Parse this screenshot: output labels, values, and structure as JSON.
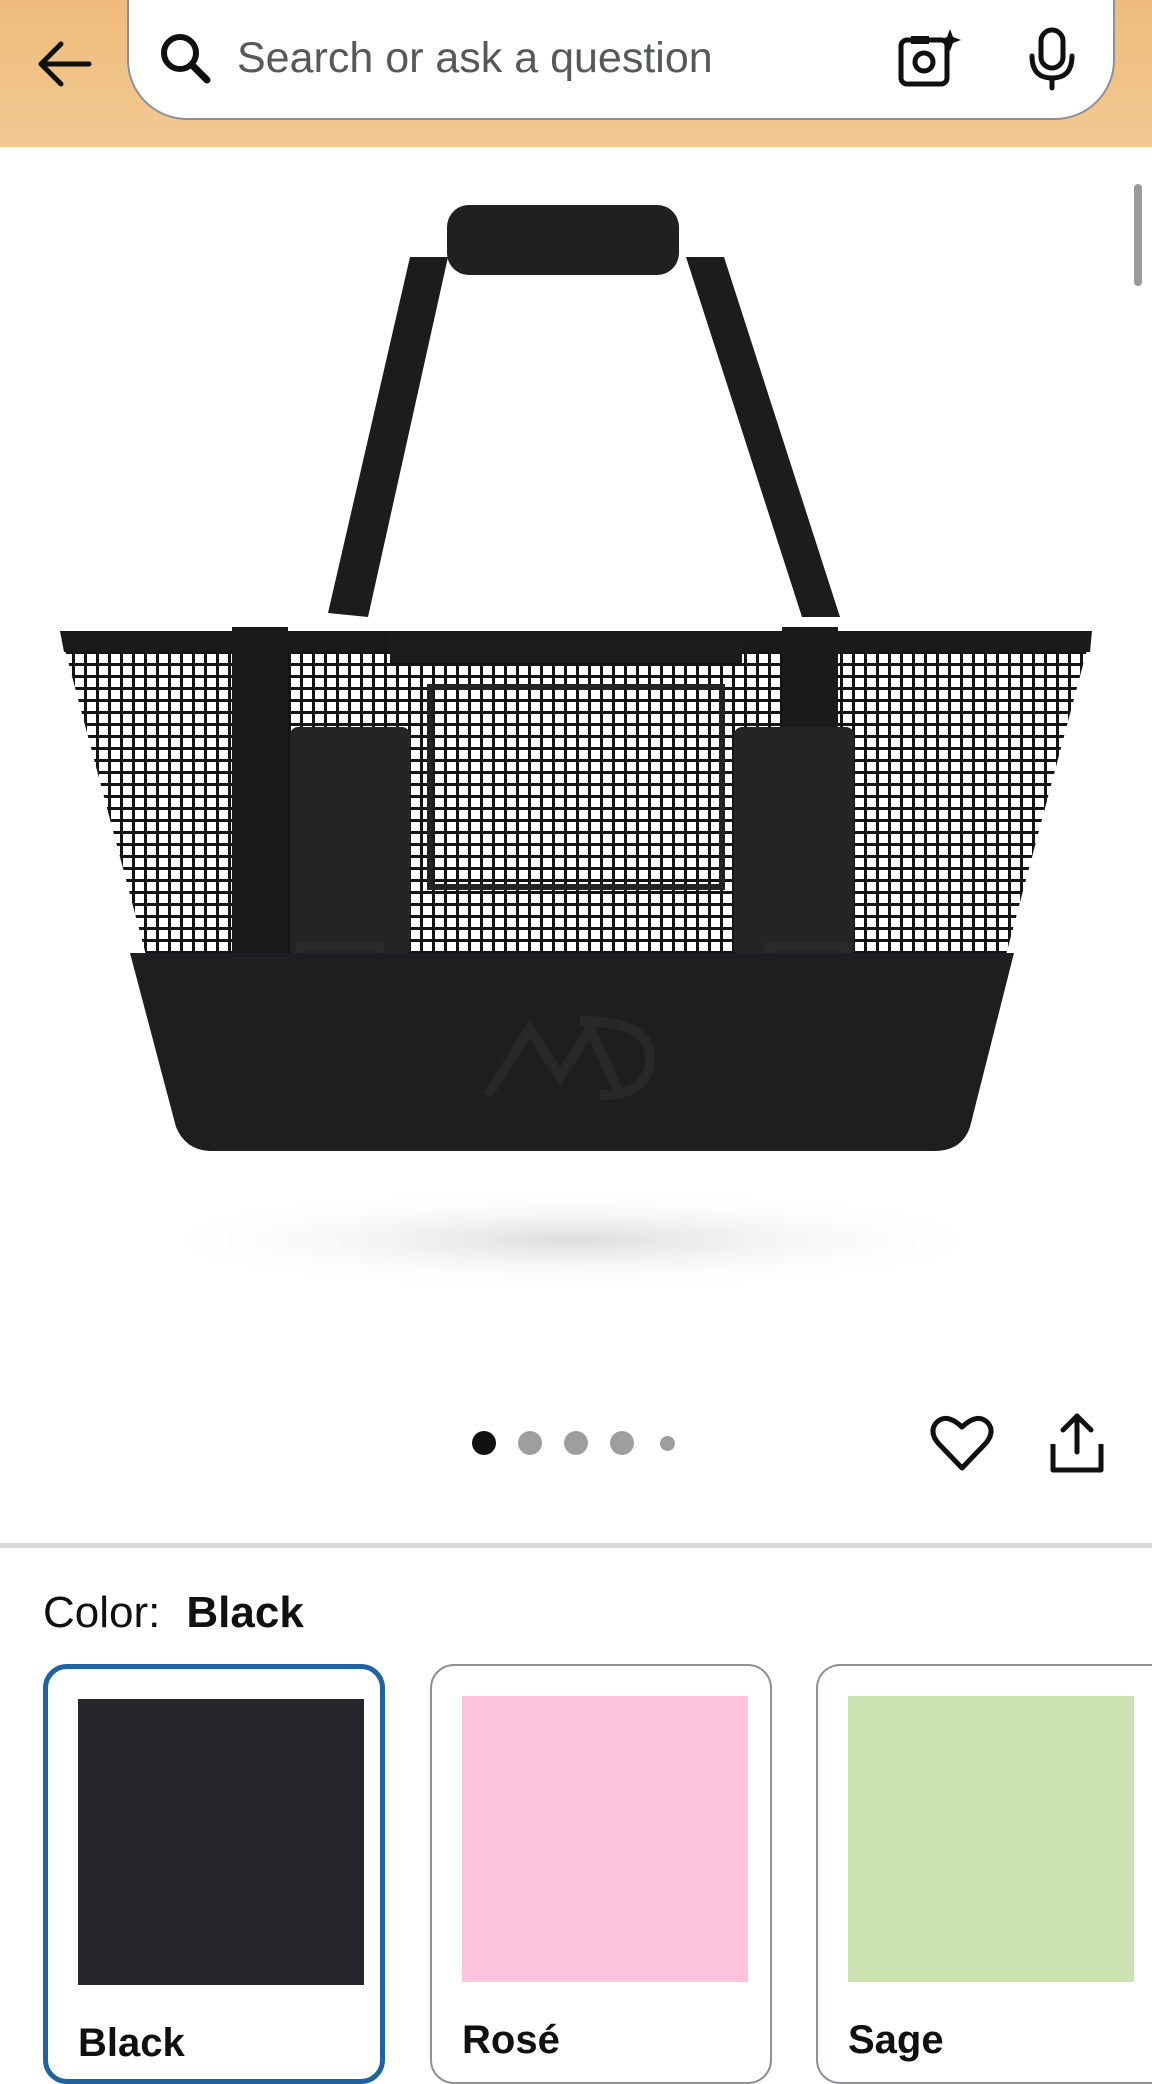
{
  "header": {
    "back_icon": "arrow-left-icon",
    "search": {
      "placeholder": "Search or ask a question",
      "search_icon": "search-icon",
      "camera_icon": "camera-sparkle-icon",
      "mic_icon": "microphone-icon"
    },
    "background_color": "#f0c084"
  },
  "product": {
    "image_description_icon": "mesh-tote-bag-image",
    "carousel": {
      "total": 5,
      "active_index": 0
    },
    "wishlist_icon": "heart-icon",
    "share_icon": "share-icon"
  },
  "variations": {
    "label": "Color:",
    "selected": "Black",
    "swatches": [
      {
        "name": "Black",
        "color": "#25272d",
        "selected": true
      },
      {
        "name": "Rosé",
        "color": "#fcc5dd",
        "selected": false
      },
      {
        "name": "Sage",
        "color": "#cde2b1",
        "selected": false
      }
    ],
    "selected_border_color": "#2162a1"
  }
}
